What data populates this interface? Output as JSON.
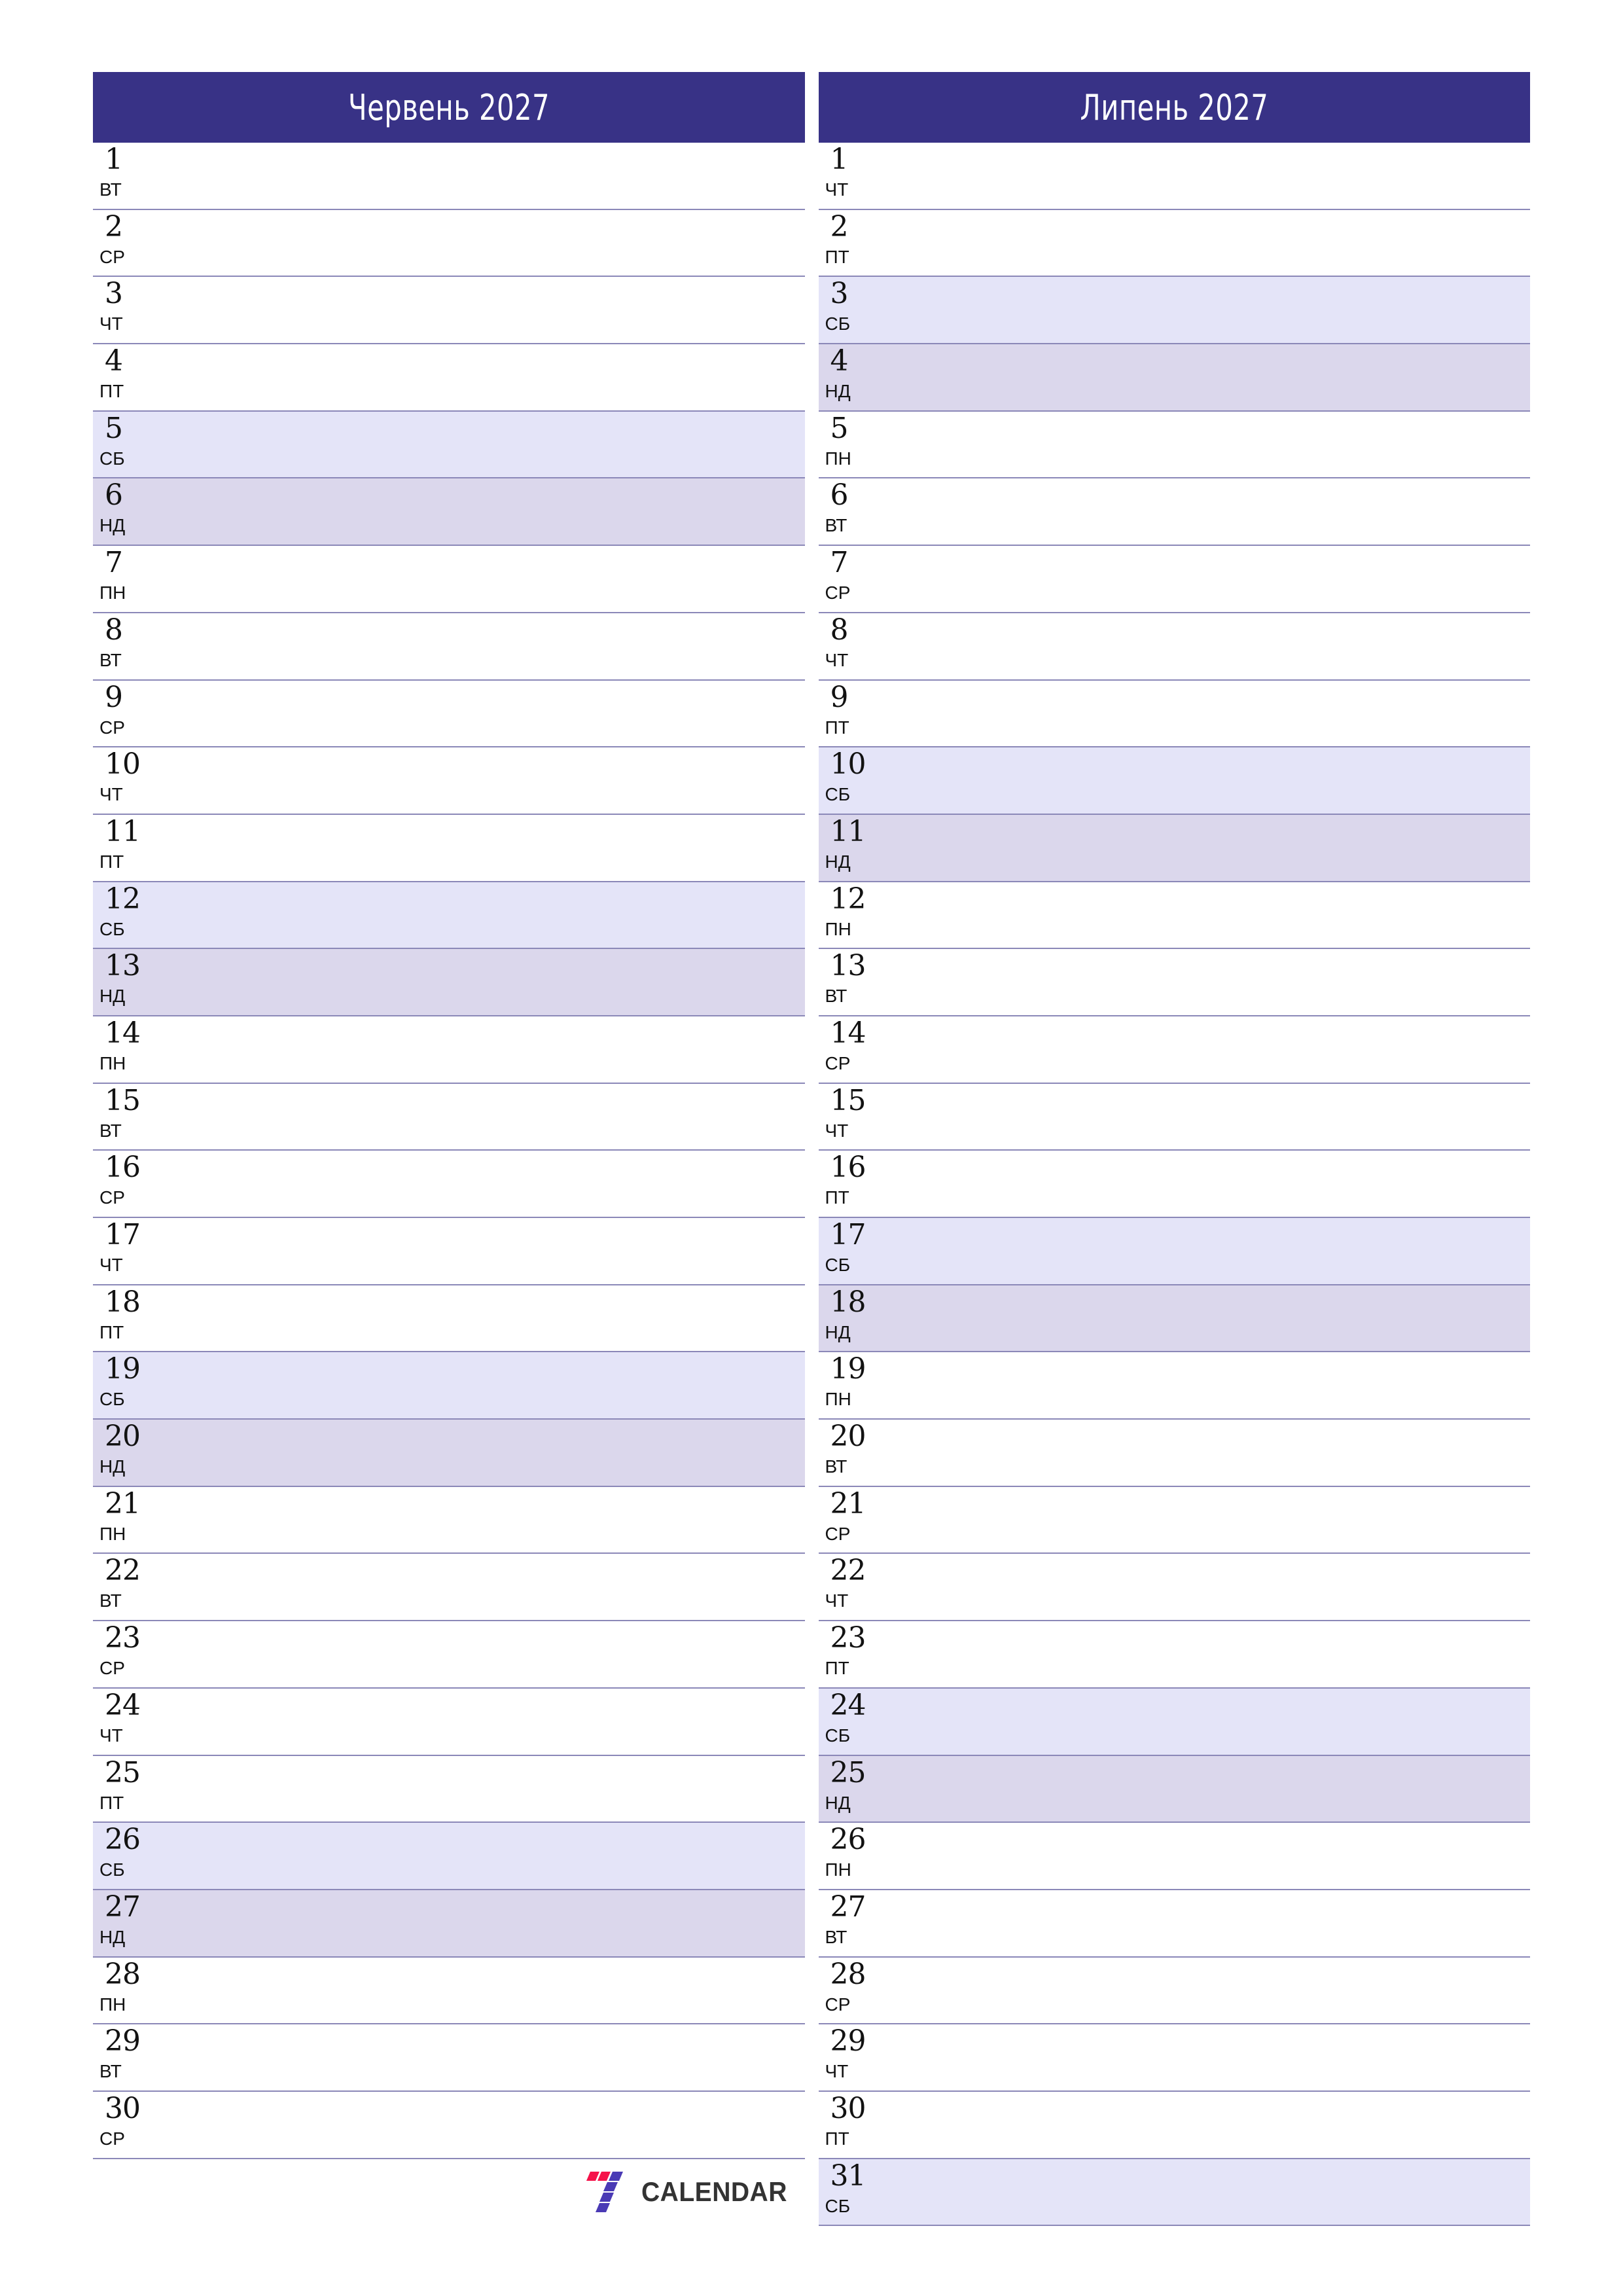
{
  "document": {
    "type": "two-month-planner",
    "year": "2027",
    "language": "uk"
  },
  "theme": {
    "header_bg": "#383286",
    "header_text": "#ffffff",
    "saturday_bg": "#e4e4f8",
    "sunday_bg": "#dbd7ec",
    "row_divider": "#8b88b8",
    "day_text": "#121212",
    "logo_red": "#f5124a",
    "logo_blue": "#4a3ab5",
    "logo_text": "#333333"
  },
  "logo": {
    "mark_name": "seven-calendar-logo",
    "text": "CALENDAR"
  },
  "months": [
    {
      "title": "Червень 2027",
      "name": "Червень",
      "year": "2027",
      "days": [
        {
          "num": "1",
          "wd": "ВТ",
          "kind": "weekday"
        },
        {
          "num": "2",
          "wd": "СР",
          "kind": "weekday"
        },
        {
          "num": "3",
          "wd": "ЧТ",
          "kind": "weekday"
        },
        {
          "num": "4",
          "wd": "ПТ",
          "kind": "weekday"
        },
        {
          "num": "5",
          "wd": "СБ",
          "kind": "sat"
        },
        {
          "num": "6",
          "wd": "НД",
          "kind": "sun"
        },
        {
          "num": "7",
          "wd": "ПН",
          "kind": "weekday"
        },
        {
          "num": "8",
          "wd": "ВТ",
          "kind": "weekday"
        },
        {
          "num": "9",
          "wd": "СР",
          "kind": "weekday"
        },
        {
          "num": "10",
          "wd": "ЧТ",
          "kind": "weekday"
        },
        {
          "num": "11",
          "wd": "ПТ",
          "kind": "weekday"
        },
        {
          "num": "12",
          "wd": "СБ",
          "kind": "sat"
        },
        {
          "num": "13",
          "wd": "НД",
          "kind": "sun"
        },
        {
          "num": "14",
          "wd": "ПН",
          "kind": "weekday"
        },
        {
          "num": "15",
          "wd": "ВТ",
          "kind": "weekday"
        },
        {
          "num": "16",
          "wd": "СР",
          "kind": "weekday"
        },
        {
          "num": "17",
          "wd": "ЧТ",
          "kind": "weekday"
        },
        {
          "num": "18",
          "wd": "ПТ",
          "kind": "weekday"
        },
        {
          "num": "19",
          "wd": "СБ",
          "kind": "sat"
        },
        {
          "num": "20",
          "wd": "НД",
          "kind": "sun"
        },
        {
          "num": "21",
          "wd": "ПН",
          "kind": "weekday"
        },
        {
          "num": "22",
          "wd": "ВТ",
          "kind": "weekday"
        },
        {
          "num": "23",
          "wd": "СР",
          "kind": "weekday"
        },
        {
          "num": "24",
          "wd": "ЧТ",
          "kind": "weekday"
        },
        {
          "num": "25",
          "wd": "ПТ",
          "kind": "weekday"
        },
        {
          "num": "26",
          "wd": "СБ",
          "kind": "sat"
        },
        {
          "num": "27",
          "wd": "НД",
          "kind": "sun"
        },
        {
          "num": "28",
          "wd": "ПН",
          "kind": "weekday"
        },
        {
          "num": "29",
          "wd": "ВТ",
          "kind": "weekday"
        },
        {
          "num": "30",
          "wd": "СР",
          "kind": "weekday"
        }
      ]
    },
    {
      "title": "Липень 2027",
      "name": "Липень",
      "year": "2027",
      "days": [
        {
          "num": "1",
          "wd": "ЧТ",
          "kind": "weekday"
        },
        {
          "num": "2",
          "wd": "ПТ",
          "kind": "weekday"
        },
        {
          "num": "3",
          "wd": "СБ",
          "kind": "sat"
        },
        {
          "num": "4",
          "wd": "НД",
          "kind": "sun"
        },
        {
          "num": "5",
          "wd": "ПН",
          "kind": "weekday"
        },
        {
          "num": "6",
          "wd": "ВТ",
          "kind": "weekday"
        },
        {
          "num": "7",
          "wd": "СР",
          "kind": "weekday"
        },
        {
          "num": "8",
          "wd": "ЧТ",
          "kind": "weekday"
        },
        {
          "num": "9",
          "wd": "ПТ",
          "kind": "weekday"
        },
        {
          "num": "10",
          "wd": "СБ",
          "kind": "sat"
        },
        {
          "num": "11",
          "wd": "НД",
          "kind": "sun"
        },
        {
          "num": "12",
          "wd": "ПН",
          "kind": "weekday"
        },
        {
          "num": "13",
          "wd": "ВТ",
          "kind": "weekday"
        },
        {
          "num": "14",
          "wd": "СР",
          "kind": "weekday"
        },
        {
          "num": "15",
          "wd": "ЧТ",
          "kind": "weekday"
        },
        {
          "num": "16",
          "wd": "ПТ",
          "kind": "weekday"
        },
        {
          "num": "17",
          "wd": "СБ",
          "kind": "sat"
        },
        {
          "num": "18",
          "wd": "НД",
          "kind": "sun"
        },
        {
          "num": "19",
          "wd": "ПН",
          "kind": "weekday"
        },
        {
          "num": "20",
          "wd": "ВТ",
          "kind": "weekday"
        },
        {
          "num": "21",
          "wd": "СР",
          "kind": "weekday"
        },
        {
          "num": "22",
          "wd": "ЧТ",
          "kind": "weekday"
        },
        {
          "num": "23",
          "wd": "ПТ",
          "kind": "weekday"
        },
        {
          "num": "24",
          "wd": "СБ",
          "kind": "sat"
        },
        {
          "num": "25",
          "wd": "НД",
          "kind": "sun"
        },
        {
          "num": "26",
          "wd": "ПН",
          "kind": "weekday"
        },
        {
          "num": "27",
          "wd": "ВТ",
          "kind": "weekday"
        },
        {
          "num": "28",
          "wd": "СР",
          "kind": "weekday"
        },
        {
          "num": "29",
          "wd": "ЧТ",
          "kind": "weekday"
        },
        {
          "num": "30",
          "wd": "ПТ",
          "kind": "weekday"
        },
        {
          "num": "31",
          "wd": "СБ",
          "kind": "sat"
        }
      ]
    }
  ]
}
